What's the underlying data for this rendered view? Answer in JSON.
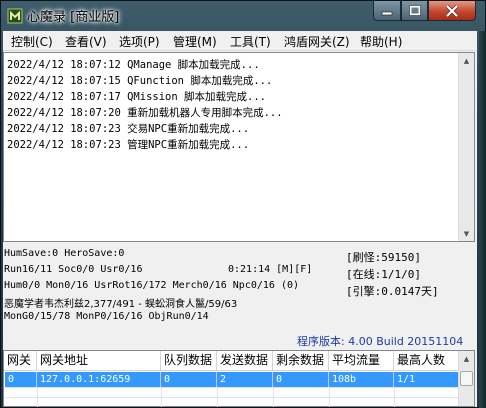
{
  "window": {
    "title": "心魔录 [商业版]",
    "accent": "#3399ff"
  },
  "icons": {
    "app": "app-logo-icon",
    "minimize": "minimize-icon",
    "maximize": "maximize-icon",
    "close": "close-icon"
  },
  "menu": [
    "控制(C)",
    "查看(V)",
    "选项(P)",
    "管理(M)",
    "工具(T)",
    "鸿盾网关(Z)",
    "帮助(H)"
  ],
  "log": [
    "2022/4/12 18:07:12 QManage 脚本加载完成...",
    "2022/4/12 18:07:15 QFunction 脚本加载完成...",
    "2022/4/12 18:07:17 QMission 脚本加载完成...",
    "2022/4/12 18:07:20 重新加载机器人专用脚本完成...",
    "2022/4/12 18:07:23 交易NPC重新加载完成...",
    "2022/4/12 18:07:23 管理NPC重新加载完成..."
  ],
  "status": {
    "line1": "HumSave:0 HeroSave:0",
    "line2": "Run16/11 Soc0/0 Usr0/16",
    "time": "0:21:14 [M][F]",
    "line3": "Hum0/0 Mon0/16 UsrRot16/172 Merch0/16 Npc0/16 (0)",
    "line4": "恶魔学者韦杰利兹2,377/491 - 蜈蚣洞食人鬣/59/63",
    "line5": "MonG0/15/78 MonP0/16/16 ObjRun0/14",
    "refresh": "[刷怪:59150]",
    "online": "[在线:1/1/0]",
    "engine": "[引擎:0.0147天]",
    "version": "程序版本: 4.00 Build 20151104"
  },
  "table": {
    "headers": [
      "网关",
      "网关地址",
      "队列数据",
      "发送数据",
      "剩余数据",
      "平均流量",
      "最高人数"
    ],
    "rows": [
      [
        "0",
        "127.0.0.1:62659",
        "0",
        "2",
        "0",
        "108b",
        "1/1"
      ]
    ]
  }
}
